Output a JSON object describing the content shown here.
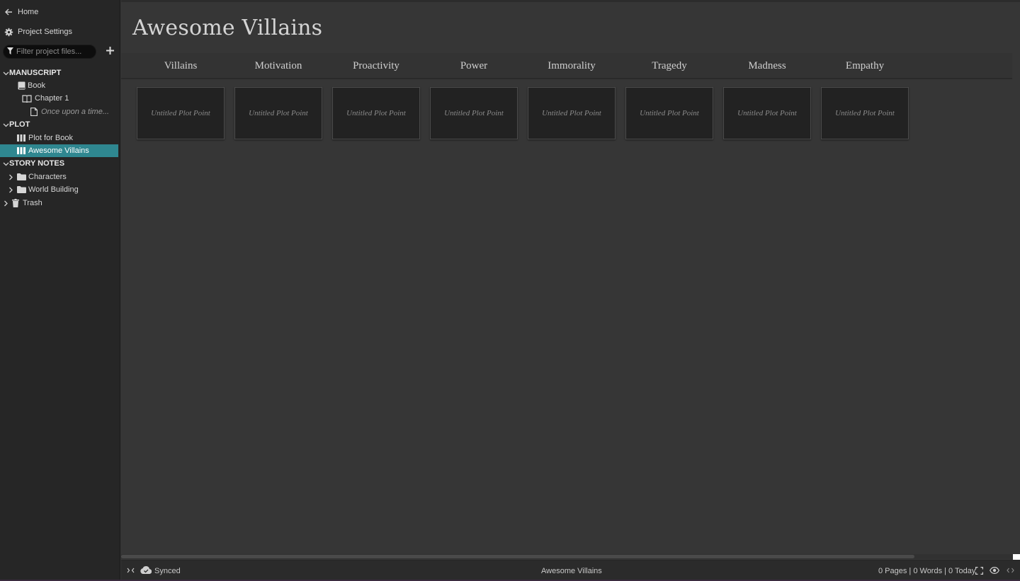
{
  "sidebar": {
    "home_label": "Home",
    "settings_label": "Project Settings",
    "filter_placeholder": "Filter project files...",
    "manuscript_header": "MANUSCRIPT",
    "book_label": "Book",
    "chapter_label": "Chapter 1",
    "scene_label": "Once upon a time...",
    "plot_header": "PLOT",
    "plot_items": [
      "Plot for Book",
      "Awesome Villains"
    ],
    "story_notes_header": "STORY NOTES",
    "characters_label": "Characters",
    "world_building_label": "World Building",
    "trash_label": "Trash",
    "selected_color": "#2f8790"
  },
  "main": {
    "title": "Awesome Villains",
    "columns": [
      "Villains",
      "Motivation",
      "Proactivity",
      "Power",
      "Immorality",
      "Tragedy",
      "Madness",
      "Empathy"
    ],
    "card_label": "Untitled Plot Point"
  },
  "statusbar": {
    "sync_label": "Synced",
    "document_name": "Awesome Villains",
    "stats": "0 Pages | 0 Words | 0 Today"
  },
  "icons": {
    "back": "arrow-left-icon",
    "settings": "gear-icon",
    "filter": "filter-icon",
    "add": "plus-icon",
    "book": "book-icon",
    "chapter": "open-book-icon",
    "scene": "document-icon",
    "plot": "columns-icon",
    "folder": "folder-icon",
    "trash": "trash-icon",
    "cloud": "cloud-icon",
    "fullscreen": "fullscreen-icon",
    "preview": "eye-icon"
  }
}
